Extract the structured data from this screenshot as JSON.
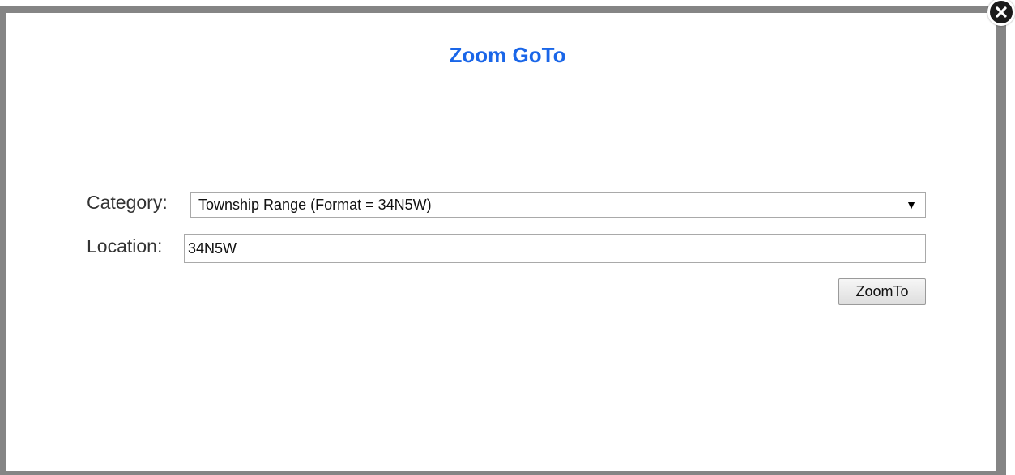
{
  "dialog": {
    "title": "Zoom GoTo"
  },
  "form": {
    "category_label": "Category:",
    "category_value": "Township Range (Format = 34N5W)",
    "location_label": "Location:",
    "location_value": "34N5W",
    "submit_label": "ZoomTo"
  },
  "icons": {
    "close": "close-icon",
    "dropdown": "dropdown-arrow-icon"
  },
  "colors": {
    "title": "#1a66e8",
    "frame": "#858585"
  }
}
